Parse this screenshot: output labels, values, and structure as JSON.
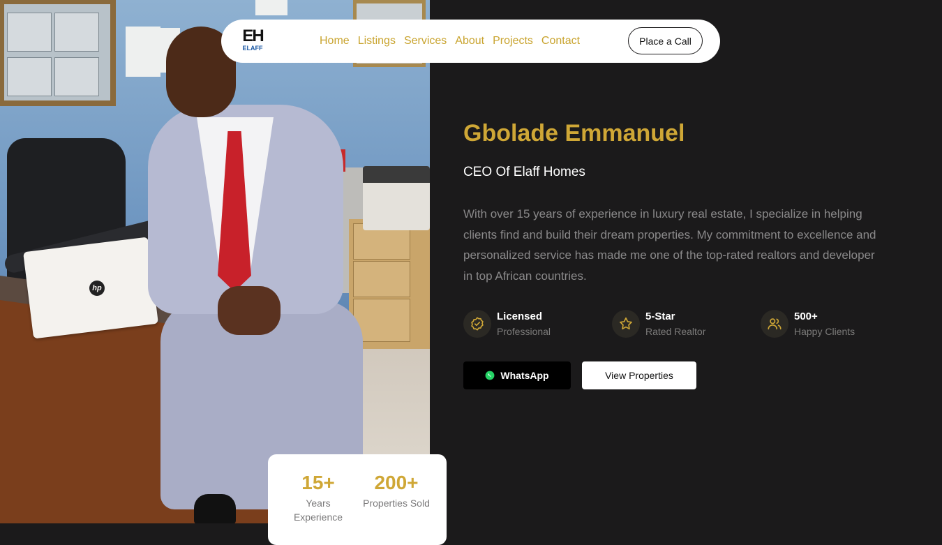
{
  "brand": {
    "logo_mark": "EH",
    "logo_text": "ELAFF"
  },
  "nav": {
    "links": [
      "Home",
      "Listings",
      "Services",
      "About",
      "Projects",
      "Contact"
    ],
    "cta_label": "Place a Call"
  },
  "hero": {
    "name": "Gbolade Emmanuel",
    "role": "CEO Of Elaff Homes",
    "bio": "With over 15 years of experience in luxury real estate, I specialize in helping clients find and build their dream properties. My commitment to excellence and personalized service has made me one of the top-rated realtors and developer in top African countries."
  },
  "features": [
    {
      "icon": "badge-check-icon",
      "title": "Licensed",
      "subtitle": "Professional"
    },
    {
      "icon": "star-icon",
      "title": "5-Star",
      "subtitle": "Rated Realtor"
    },
    {
      "icon": "users-icon",
      "title": "500+",
      "subtitle": "Happy Clients"
    }
  ],
  "buttons": {
    "whatsapp_label": "WhatsApp",
    "view_properties_label": "View Properties"
  },
  "stats": [
    {
      "value": "15+",
      "label_line1": "Years",
      "label_line2": "Experience"
    },
    {
      "value": "200+",
      "label_line1": "Properties Sold",
      "label_line2": ""
    }
  ],
  "colors": {
    "accent_gold": "#cfa736",
    "background": "#1b1a1b",
    "muted_text": "#8a898a",
    "whatsapp_green": "#25d366"
  },
  "photo": {
    "laptop_logo": "hp"
  }
}
